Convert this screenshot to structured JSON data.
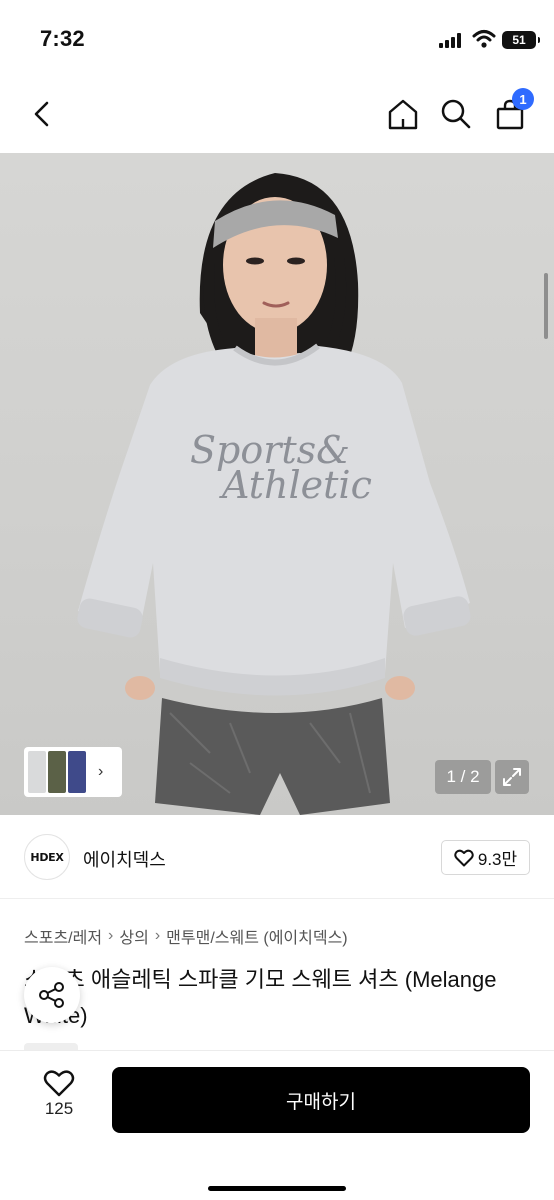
{
  "status_bar": {
    "time": "7:32",
    "battery": "51",
    "icons": [
      "signal-icon",
      "wifi-icon",
      "battery-icon"
    ]
  },
  "nav": {
    "icons": [
      "back-icon",
      "home-icon",
      "search-icon",
      "cart-icon"
    ],
    "cart_count": "1"
  },
  "gallery": {
    "print_line1": "Sports&",
    "print_line2": "Athletic",
    "page_counter": "1 / 2",
    "thumb_colors": [
      "#d9dadb",
      "#5b6147",
      "#3f4a8a"
    ],
    "expand_icon": "expand-icon"
  },
  "brand": {
    "logo_text": "HDEX",
    "name": "에이치덱스",
    "like_count": "9.3만"
  },
  "breadcrumb": [
    "스포츠/레저",
    "상의",
    "맨투맨/스웨트 (에이치덱스)"
  ],
  "product": {
    "title": "스포츠 애슬레틱 스파클 기모 스웨트 셔츠 (Melange White)",
    "share_icon": "share-icon"
  },
  "bottom_bar": {
    "wish_count": "125",
    "buy_label": "구매하기"
  },
  "colors": {
    "accent": "#2f6bff",
    "buy_button": "#000000",
    "background": "#ffffff"
  }
}
